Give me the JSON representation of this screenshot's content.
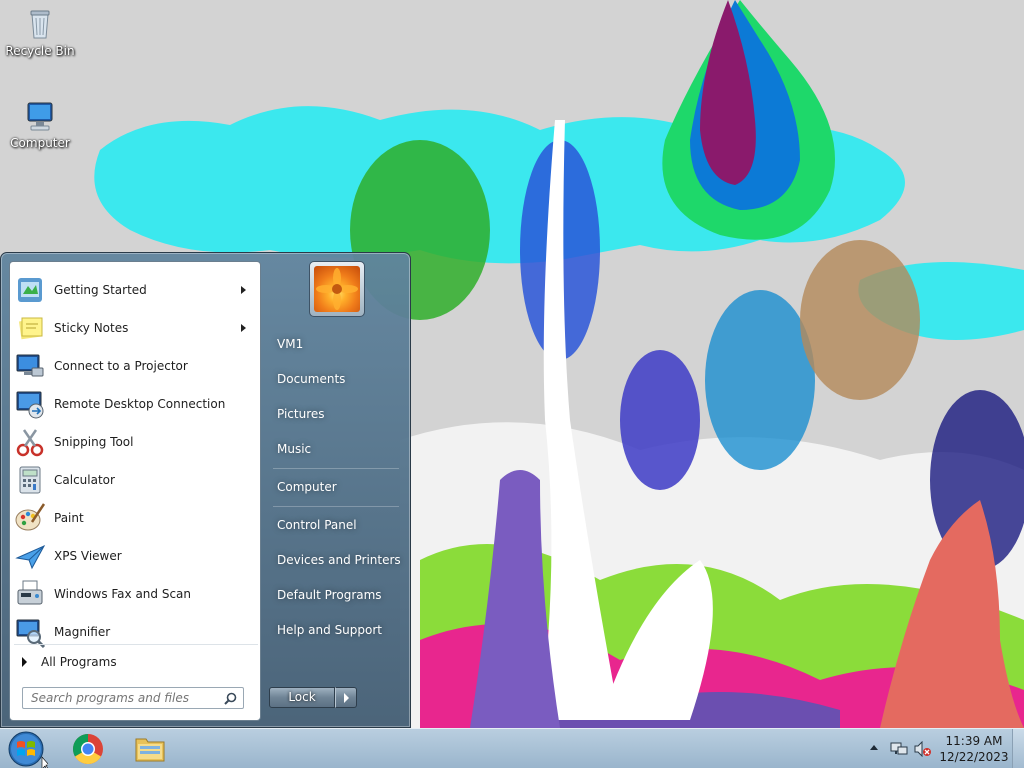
{
  "desktop": {
    "icons": [
      {
        "label": "Recycle Bin",
        "icon": "recycle-bin-icon"
      },
      {
        "label": "Computer",
        "icon": "computer-icon"
      }
    ]
  },
  "start_menu": {
    "programs": [
      {
        "label": "Getting Started",
        "icon": "getting-started-icon",
        "submenu": true
      },
      {
        "label": "Sticky Notes",
        "icon": "sticky-notes-icon",
        "submenu": true
      },
      {
        "label": "Connect to a Projector",
        "icon": "projector-icon",
        "submenu": false
      },
      {
        "label": "Remote Desktop Connection",
        "icon": "remote-desktop-icon",
        "submenu": false
      },
      {
        "label": "Snipping Tool",
        "icon": "snipping-tool-icon",
        "submenu": false
      },
      {
        "label": "Calculator",
        "icon": "calculator-icon",
        "submenu": false
      },
      {
        "label": "Paint",
        "icon": "paint-icon",
        "submenu": false
      },
      {
        "label": "XPS Viewer",
        "icon": "xps-viewer-icon",
        "submenu": false
      },
      {
        "label": "Windows Fax and Scan",
        "icon": "fax-scan-icon",
        "submenu": false
      },
      {
        "label": "Magnifier",
        "icon": "magnifier-icon",
        "submenu": false
      }
    ],
    "all_programs": "All Programs",
    "search_placeholder": "Search programs and files",
    "right_items": [
      "VM1",
      "Documents",
      "Pictures",
      "Music",
      "Computer",
      "Control Panel",
      "Devices and Printers",
      "Default Programs",
      "Help and Support"
    ],
    "lock_label": "Lock"
  },
  "taskbar": {
    "apps": [
      {
        "name": "chrome",
        "icon": "chrome-icon"
      },
      {
        "name": "file-explorer",
        "icon": "folder-icon"
      }
    ],
    "clock": {
      "time": "11:39 AM",
      "date": "12/22/2023"
    }
  },
  "colors": {
    "start_menu_frame": "#60849e",
    "taskbar": "#b8cee0",
    "sky": "#d3d3d3",
    "cloud": "#3be8ee"
  }
}
